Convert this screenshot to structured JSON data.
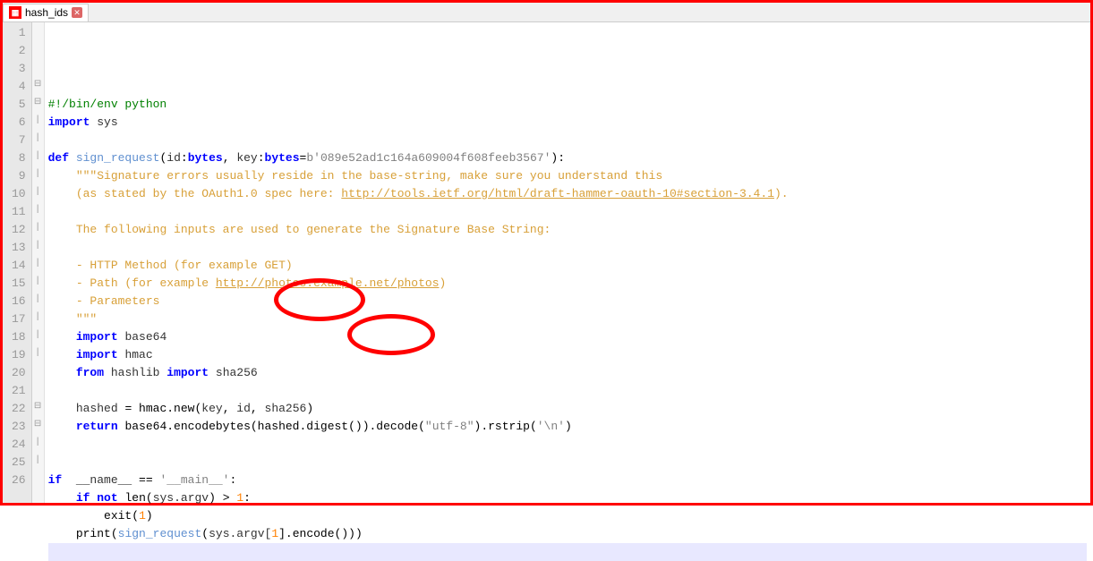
{
  "tab": {
    "title": "hash_ids"
  },
  "code": {
    "lines": [
      {
        "n": 1,
        "fold": "",
        "t": "shebang"
      },
      {
        "n": 2,
        "fold": "",
        "t": "import_sys"
      },
      {
        "n": 3,
        "fold": "",
        "t": "blank"
      },
      {
        "n": 4,
        "fold": "⊟",
        "t": "def_sign"
      },
      {
        "n": 5,
        "fold": "⊟",
        "t": "doc1"
      },
      {
        "n": 6,
        "fold": "|",
        "t": "doc2"
      },
      {
        "n": 7,
        "fold": "|",
        "t": "blank"
      },
      {
        "n": 8,
        "fold": "|",
        "t": "doc3"
      },
      {
        "n": 9,
        "fold": "|",
        "t": "blank"
      },
      {
        "n": 10,
        "fold": "|",
        "t": "doc4"
      },
      {
        "n": 11,
        "fold": "|",
        "t": "doc5"
      },
      {
        "n": 12,
        "fold": "|",
        "t": "doc6"
      },
      {
        "n": 13,
        "fold": "|",
        "t": "doc7"
      },
      {
        "n": 14,
        "fold": "|",
        "t": "import_b64"
      },
      {
        "n": 15,
        "fold": "|",
        "t": "import_hmac"
      },
      {
        "n": 16,
        "fold": "|",
        "t": "from_hashlib"
      },
      {
        "n": 17,
        "fold": "|",
        "t": "blank"
      },
      {
        "n": 18,
        "fold": "|",
        "t": "hashed"
      },
      {
        "n": 19,
        "fold": "|",
        "t": "return"
      },
      {
        "n": 20,
        "fold": "",
        "t": "blank"
      },
      {
        "n": 21,
        "fold": "",
        "t": "blank"
      },
      {
        "n": 22,
        "fold": "⊟",
        "t": "if_main"
      },
      {
        "n": 23,
        "fold": "⊟",
        "t": "if_not"
      },
      {
        "n": 24,
        "fold": "|",
        "t": "exit"
      },
      {
        "n": 25,
        "fold": "|",
        "t": "print"
      },
      {
        "n": 26,
        "fold": "",
        "t": "blank_last"
      }
    ]
  },
  "tokens": {
    "shebang": "#!/bin/env python",
    "kw_import": "import",
    "kw_def": "def",
    "kw_from": "from",
    "kw_return": "return",
    "kw_if": "if",
    "kw_not": "not",
    "sys": "sys",
    "sign_request": "sign_request",
    "lp": "(",
    "rp": ")",
    "id": "id",
    "colon": ":",
    "bytes": "bytes",
    "comma": ", ",
    "key": "key",
    "eq": "=",
    "defkey": "b'089e52ad1c164a609004f608feeb3567'",
    "doc_open": "\"\"\"",
    "doc1b": "Signature errors usually reside in the base-string, make sure you understand this",
    "doc2a": "(as stated by the OAuth1.0 spec here: ",
    "doc2_url": "http://tools.ietf.org/html/draft-hammer-oauth-10#section-3.4.1",
    "doc2b": ").",
    "doc3": "The following inputs are used to generate the Signature Base String:",
    "doc4": "- HTTP Method (for example GET)",
    "doc5a": "- Path (for example ",
    "doc5_url": "http://photos.example.net/photos",
    "doc5b": ")",
    "doc6": "- Parameters",
    "doc_close": "\"\"\"",
    "base64": "base64",
    "hmac": "hmac",
    "hashlib": "hashlib",
    "sha256": "sha256",
    "hashed": "hashed",
    "hmac_new": "hmac.new",
    "return_expr_a": "base64.encodebytes(hashed.digest()).decode(",
    "utf8": "\"utf-8\"",
    "return_expr_b": ").rstrip(",
    "nl": "'\\n'",
    "name": "__name__",
    "eqeq": " == ",
    "main": "'__main__'",
    "len": "len",
    "sysargv": "sys.argv",
    "gt": " > ",
    "one": "1",
    "exit": "exit",
    "print": "print",
    "sysargv1": "sys.argv[",
    "bracket1": "1",
    "bracketend": "].encode()"
  }
}
